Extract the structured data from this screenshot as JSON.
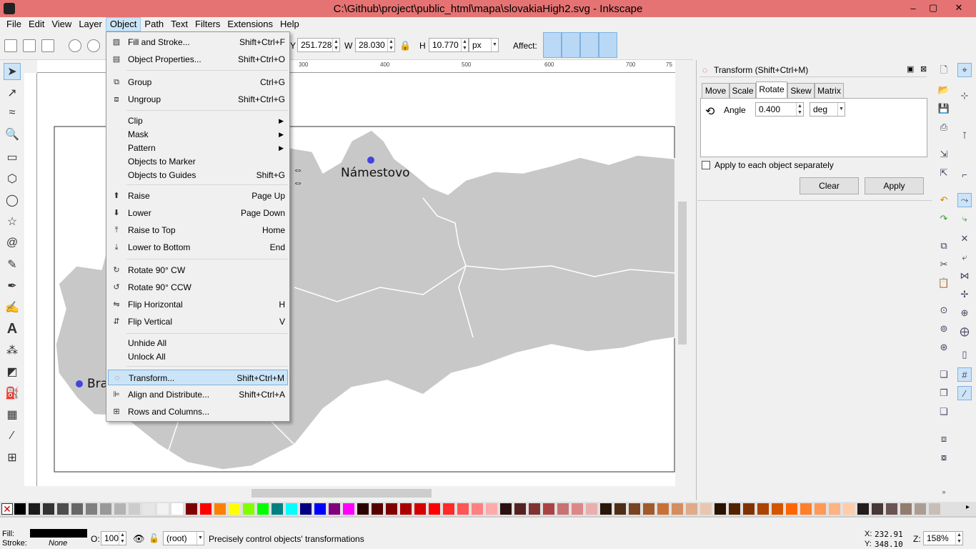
{
  "window": {
    "title": "C:\\Github\\project\\public_html\\mapa\\slovakiaHigh2.svg - Inkscape",
    "min": "–",
    "max": "▢",
    "close": "✕"
  },
  "menubar": [
    "File",
    "Edit",
    "View",
    "Layer",
    "Object",
    "Path",
    "Text",
    "Filters",
    "Extensions",
    "Help"
  ],
  "toolbar": {
    "y_value": "251.728",
    "w_label": "W",
    "w_value": "28.030",
    "h_label": "H",
    "h_value": "10.770",
    "unit": "px",
    "affect_label": "Affect:",
    "y_prefix": "Y"
  },
  "object_menu": [
    {
      "label": "Fill and Stroke...",
      "shortcut": "Shift+Ctrl+F",
      "icon": "fill-stroke-icon"
    },
    {
      "label": "Object Properties...",
      "shortcut": "Shift+Ctrl+O",
      "icon": "object-properties-icon"
    },
    {
      "label": "Group",
      "shortcut": "Ctrl+G",
      "icon": "group-icon"
    },
    {
      "label": "Ungroup",
      "shortcut": "Shift+Ctrl+G",
      "icon": "ungroup-icon"
    },
    {
      "label": "Clip",
      "shortcut": "",
      "submenu": true
    },
    {
      "label": "Mask",
      "shortcut": "",
      "submenu": true
    },
    {
      "label": "Pattern",
      "shortcut": "",
      "submenu": true
    },
    {
      "label": "Objects to Marker",
      "shortcut": ""
    },
    {
      "label": "Objects to Guides",
      "shortcut": "Shift+G"
    },
    {
      "label": "Raise",
      "shortcut": "Page Up",
      "icon": "raise-icon"
    },
    {
      "label": "Lower",
      "shortcut": "Page Down",
      "icon": "lower-icon"
    },
    {
      "label": "Raise to Top",
      "shortcut": "Home",
      "icon": "raise-to-top-icon"
    },
    {
      "label": "Lower to Bottom",
      "shortcut": "End",
      "icon": "lower-to-bottom-icon"
    },
    {
      "label": "Rotate 90° CW",
      "shortcut": "",
      "icon": "rotate-cw-icon"
    },
    {
      "label": "Rotate 90° CCW",
      "shortcut": "",
      "icon": "rotate-ccw-icon"
    },
    {
      "label": "Flip Horizontal",
      "shortcut": "H",
      "icon": "flip-horizontal-icon"
    },
    {
      "label": "Flip Vertical",
      "shortcut": "V",
      "icon": "flip-vertical-icon"
    },
    {
      "label": "Unhide All",
      "shortcut": ""
    },
    {
      "label": "Unlock All",
      "shortcut": ""
    },
    {
      "label": "Transform...",
      "shortcut": "Shift+Ctrl+M",
      "icon": "transform-icon",
      "highlighted": true
    },
    {
      "label": "Align and Distribute...",
      "shortcut": "Shift+Ctrl+A",
      "icon": "align-icon"
    },
    {
      "label": "Rows and Columns...",
      "shortcut": "",
      "icon": "grid-arrange-icon"
    }
  ],
  "ruler_top": [
    "300",
    "400",
    "500",
    "600",
    "700",
    "75"
  ],
  "canvas": {
    "city1": "Námestovo",
    "city2": "Bra"
  },
  "transform_dialog": {
    "title": "Transform (Shift+Ctrl+M)",
    "tabs": [
      "Move",
      "Scale",
      "Rotate",
      "Skew",
      "Matrix"
    ],
    "active_tab": "Rotate",
    "angle_label": "Angle",
    "angle_value": "0.400",
    "angle_unit": "deg",
    "apply_each": "Apply to each object separately",
    "clear": "Clear",
    "apply": "Apply"
  },
  "status": {
    "fill_label": "Fill:",
    "stroke_label": "Stroke:",
    "stroke_value": "None",
    "opacity_label": "O:",
    "opacity_value": "100",
    "layer": "(root)",
    "message": "Precisely control objects' transformations",
    "x_label": "X:",
    "x_value": "232.91",
    "y_label": "Y:",
    "y_value": "348.10",
    "zoom_label": "Z:",
    "zoom_value": "158%"
  },
  "palette_colors": [
    "#000000",
    "#1a1a1a",
    "#333333",
    "#4d4d4d",
    "#666666",
    "#808080",
    "#999999",
    "#b3b3b3",
    "#cccccc",
    "#e6e6e6",
    "#f2f2f2",
    "#ffffff",
    "#800000",
    "#ff0000",
    "#ff8000",
    "#ffff00",
    "#80ff00",
    "#00ff00",
    "#008080",
    "#00ffff",
    "#000080",
    "#0000ff",
    "#800080",
    "#ff00ff",
    "#2b0000",
    "#550000",
    "#800000",
    "#aa0000",
    "#d40000",
    "#ff0000",
    "#ff2a2a",
    "#ff5555",
    "#ff8080",
    "#ffaaaa",
    "#2b1111",
    "#552222",
    "#803333",
    "#aa4444",
    "#c87373",
    "#de8787",
    "#e9afaf",
    "#28170b",
    "#502d16",
    "#784421",
    "#a05a2c",
    "#c87137",
    "#d38d5f",
    "#deaa87",
    "#e9c6af",
    "#2b1100",
    "#552200",
    "#803300",
    "#aa4400",
    "#d45500",
    "#ff6600",
    "#ff7f2a",
    "#ff9955",
    "#ffb380",
    "#ffccaa",
    "#241c1c",
    "#483737",
    "#6c5353",
    "#917c6f",
    "#ac9d93",
    "#c8beb7"
  ]
}
